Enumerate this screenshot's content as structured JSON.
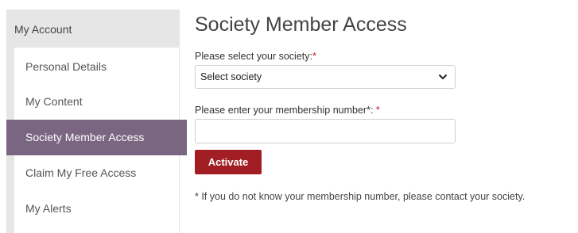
{
  "sidebar": {
    "header": "My Account",
    "items": [
      {
        "label": "Personal Details",
        "active": false
      },
      {
        "label": "My Content",
        "active": false
      },
      {
        "label": "Society Member Access",
        "active": true
      },
      {
        "label": "Claim My Free Access",
        "active": false
      },
      {
        "label": "My Alerts",
        "active": false
      }
    ]
  },
  "main": {
    "title": "Society Member Access",
    "society_label": "Please select your society:",
    "society_required_mark": "*",
    "society_select": {
      "value": "Select society",
      "icon": "chevron-down-icon"
    },
    "membership_label": "Please enter your membership number*: ",
    "membership_required_mark": "*",
    "membership_input": {
      "value": "",
      "placeholder": ""
    },
    "activate_label": "Activate",
    "note": "* If you do not know your membership number, please contact your society."
  },
  "colors": {
    "accent": "#a21e25",
    "active_item": "#7a6680",
    "sidebar_bg": "#e6e6e6"
  }
}
